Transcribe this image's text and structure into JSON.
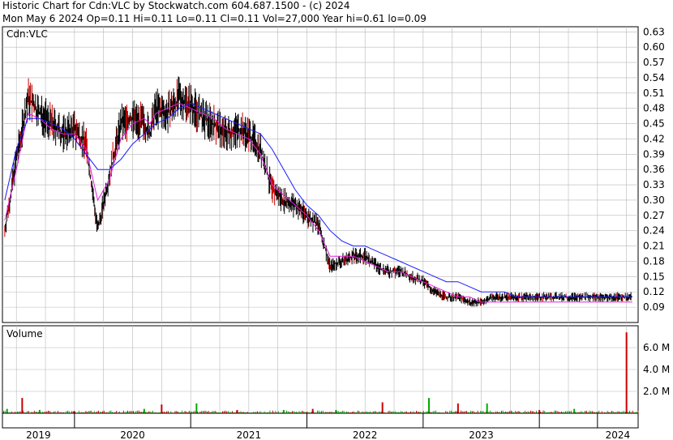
{
  "header": {
    "line1": "Historic Chart for Cdn:VLC by Stockwatch.com 604.687.1500 - (c) 2024",
    "line2": "Mon May  6 2024  Op=0.11  Hi=0.11  Lo=0.11  Cl=0.11  Vol=27,000  Year hi=0.61  lo=0.09"
  },
  "colors": {
    "price_bar": "#000000",
    "down_tick": "#cc0000",
    "ma_short": "#e020e0",
    "ma_long": "#1a1aff",
    "vol_up": "#00aa00",
    "vol_down": "#cc0000",
    "grid": "#b8b8b8"
  },
  "chart_data": [
    {
      "type": "line",
      "title": "Cdn:VLC",
      "ylabel": "",
      "xlabel": "",
      "ylim": [
        0.06,
        0.64
      ],
      "yticks": [
        0.63,
        0.6,
        0.57,
        0.54,
        0.51,
        0.48,
        0.45,
        0.42,
        0.39,
        0.36,
        0.33,
        0.3,
        0.27,
        0.24,
        0.21,
        0.18,
        0.15,
        0.12,
        0.09
      ],
      "x_tick_labels": [
        "2019",
        "2020",
        "2021",
        "2022",
        "2023",
        "2024"
      ],
      "x": [
        2018.9,
        2019.0,
        2019.1,
        2019.2,
        2019.3,
        2019.4,
        2019.5,
        2019.6,
        2019.7,
        2019.8,
        2019.9,
        2020.0,
        2020.1,
        2020.15,
        2020.2,
        2020.3,
        2020.4,
        2020.5,
        2020.6,
        2020.7,
        2020.8,
        2020.9,
        2021.0,
        2021.1,
        2021.2,
        2021.3,
        2021.4,
        2021.5,
        2021.6,
        2021.7,
        2021.8,
        2021.9,
        2022.0,
        2022.1,
        2022.2,
        2022.3,
        2022.4,
        2022.5,
        2022.6,
        2022.7,
        2022.8,
        2022.9,
        2023.0,
        2023.1,
        2023.2,
        2023.3,
        2023.4,
        2023.5,
        2023.6,
        2023.7,
        2023.8,
        2023.9,
        2024.0,
        2024.1,
        2024.2,
        2024.3
      ],
      "series": [
        {
          "values": [
            0.24,
            0.38,
            0.5,
            0.47,
            0.45,
            0.43,
            0.44,
            0.41,
            0.24,
            0.35,
            0.45,
            0.46,
            0.45,
            0.43,
            0.48,
            0.47,
            0.5,
            0.49,
            0.46,
            0.45,
            0.43,
            0.44,
            0.43,
            0.4,
            0.32,
            0.3,
            0.29,
            0.27,
            0.25,
            0.17,
            0.18,
            0.19,
            0.19,
            0.17,
            0.16,
            0.16,
            0.15,
            0.14,
            0.12,
            0.11,
            0.11,
            0.1,
            0.1,
            0.11,
            0.11,
            0.11,
            0.11,
            0.11,
            0.11,
            0.11,
            0.11,
            0.11,
            0.11,
            0.11,
            0.11,
            0.11
          ]
        },
        {
          "values": [
            0.26,
            0.36,
            0.47,
            0.46,
            0.44,
            0.43,
            0.43,
            0.4,
            0.3,
            0.34,
            0.42,
            0.45,
            0.46,
            0.45,
            0.47,
            0.48,
            0.49,
            0.48,
            0.47,
            0.46,
            0.44,
            0.43,
            0.42,
            0.39,
            0.33,
            0.31,
            0.29,
            0.27,
            0.24,
            0.19,
            0.19,
            0.19,
            0.18,
            0.17,
            0.16,
            0.16,
            0.15,
            0.14,
            0.13,
            0.12,
            0.11,
            0.11,
            0.1,
            0.1,
            0.1,
            0.1,
            0.1,
            0.1,
            0.1,
            0.1,
            0.1,
            0.1,
            0.1,
            0.1,
            0.1,
            0.1
          ]
        },
        {
          "values": [
            0.3,
            0.4,
            0.46,
            0.46,
            0.45,
            0.44,
            0.42,
            0.39,
            0.36,
            0.36,
            0.38,
            0.41,
            0.43,
            0.44,
            0.45,
            0.46,
            0.48,
            0.49,
            0.48,
            0.47,
            0.46,
            0.45,
            0.44,
            0.43,
            0.4,
            0.36,
            0.32,
            0.29,
            0.27,
            0.24,
            0.22,
            0.21,
            0.21,
            0.2,
            0.19,
            0.18,
            0.17,
            0.16,
            0.15,
            0.14,
            0.14,
            0.13,
            0.12,
            0.12,
            0.12,
            0.11,
            0.11,
            0.11,
            0.11,
            0.11,
            0.11,
            0.11,
            0.11,
            0.11,
            0.11,
            0.11
          ]
        }
      ]
    },
    {
      "type": "bar",
      "title": "Volume",
      "ylim": [
        0,
        8.0
      ],
      "ytick_labels": [
        "6.0 M",
        "4.0 M",
        "2.0 M"
      ],
      "yticks": [
        6.0,
        4.0,
        2.0
      ],
      "x": [
        2018.92,
        2019.05,
        2019.2,
        2019.5,
        2020.1,
        2020.25,
        2020.55,
        2020.9,
        2021.3,
        2021.55,
        2021.75,
        2022.15,
        2022.55,
        2022.8,
        2023.05,
        2023.5,
        2023.8,
        2024.25
      ],
      "values": [
        0.4,
        1.4,
        0.3,
        0.2,
        0.4,
        0.8,
        0.9,
        0.3,
        0.3,
        0.4,
        0.3,
        1.0,
        1.4,
        0.9,
        0.9,
        0.3,
        0.4,
        7.4
      ]
    }
  ]
}
